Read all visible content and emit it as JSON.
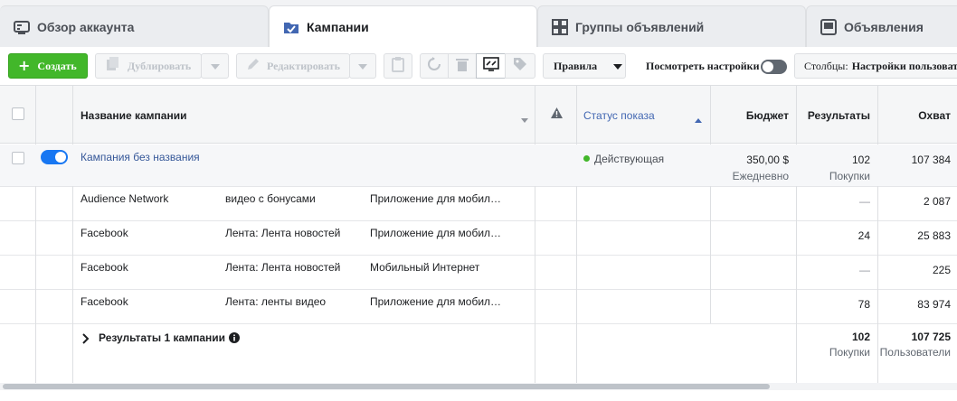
{
  "tabs": [
    {
      "label": "Обзор аккаунта",
      "icon": "account-overview-icon",
      "active": false
    },
    {
      "label": "Кампании",
      "icon": "campaign-folder-icon",
      "active": true
    },
    {
      "label": "Группы объявлений",
      "icon": "ad-sets-grid-icon",
      "active": false
    },
    {
      "label": "Объявления",
      "icon": "ads-icon",
      "active": false
    }
  ],
  "toolbar": {
    "create_label": "Создать",
    "duplicate_label": "Дублировать",
    "edit_label": "Редактировать",
    "rules_label": "Правила",
    "view_settings_label": "Посмотреть настройки",
    "columns_prefix": "Столбцы:",
    "columns_value": "Настройки пользователя"
  },
  "table": {
    "headers": {
      "name": "Название кампании",
      "status": "Статус показа",
      "budget": "Бюджет",
      "results": "Результаты",
      "reach": "Охват"
    },
    "campaign": {
      "name": "Кампания без названия",
      "status": "Действующая",
      "budget": "350,00 $",
      "budget_period": "Ежедневно",
      "results": "102",
      "results_type": "Покупки",
      "reach": "107 384"
    },
    "breakdown_rows": [
      {
        "platform": "Audience Network",
        "placement": "видео с бонусами",
        "device": "Приложение для мобил…",
        "results": "—",
        "reach": "2 087"
      },
      {
        "platform": "Facebook",
        "placement": "Лента: Лента новостей",
        "device": "Приложение для мобил…",
        "results": "24",
        "reach": "25 883"
      },
      {
        "platform": "Facebook",
        "placement": "Лента: Лента новостей",
        "device": "Мобильный Интернет",
        "results": "—",
        "reach": "225"
      },
      {
        "platform": "Facebook",
        "placement": "Лента: ленты видео",
        "device": "Приложение для мобил…",
        "results": "78",
        "reach": "83 974"
      }
    ],
    "summary": {
      "label": "Результаты 1 кампании",
      "results": "102",
      "results_type": "Покупки",
      "reach": "107 725",
      "reach_type": "Пользователи"
    }
  },
  "colors": {
    "create_green": "#42b72a",
    "toggle_blue": "#1877f2",
    "link_blue": "#365899",
    "status_green": "#42b72a"
  }
}
